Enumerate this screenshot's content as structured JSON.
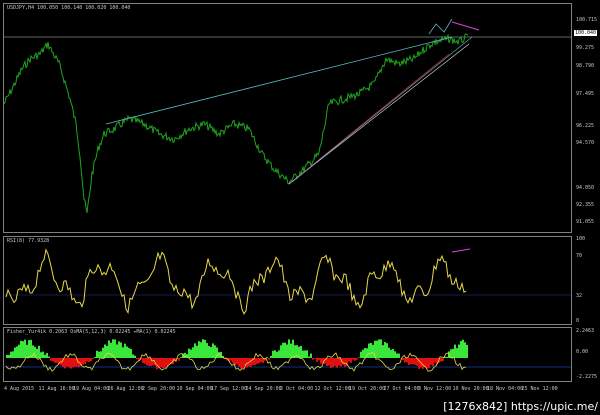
{
  "price_pane": {
    "title": "USDJPY,H4  100.050  100.140  100.020  100.040",
    "current_price_tag": "100.040",
    "axis_labels": [
      "100.715",
      "99.275",
      "98.790",
      "97.495",
      "96.225",
      "94.570",
      "94.050",
      "92.355",
      "91.055"
    ]
  },
  "rsi_pane": {
    "title": "RSI(8) 77.9328",
    "axis_labels": [
      "100",
      "70",
      "32",
      "0"
    ]
  },
  "fisher_pane": {
    "title": "Fisher_Yur4ik 0.2063  OsMA(5,12,3) 0.02245  ↔MA(1) 0.02245",
    "axis_labels": [
      "2.2463",
      "0.00",
      "-2.2275"
    ]
  },
  "time_axis": [
    "4 Aug 2015",
    "11 Aug 16:00",
    "19 Aug 04:00",
    "26 Aug 12:00",
    "2 Sep 20:00",
    "10 Sep 04:00",
    "17 Sep 12:00",
    "24 Sep 20:00",
    "2 Oct 04:00",
    "12 Oct 12:00",
    "19 Oct 20:00",
    "27 Oct 04:00",
    "3 Nov 12:00",
    "10 Nov 20:00",
    "18 Nov 04:00",
    "25 Nov 12:00"
  ],
  "watermark": "[1276x842] https://upic.me/",
  "colors": {
    "price": "#1fa51f",
    "rsi": "#e8d84a",
    "trend_upper": "#5fb6c9",
    "trend_red": "#c8282a",
    "trend_white": "#e0e0e0",
    "divergence": "#e040e0",
    "fisher_green": "#39e639",
    "fisher_red": "#e01010",
    "fisher_line": "#e8d84a",
    "fisher_blue": "#2060ff"
  }
}
